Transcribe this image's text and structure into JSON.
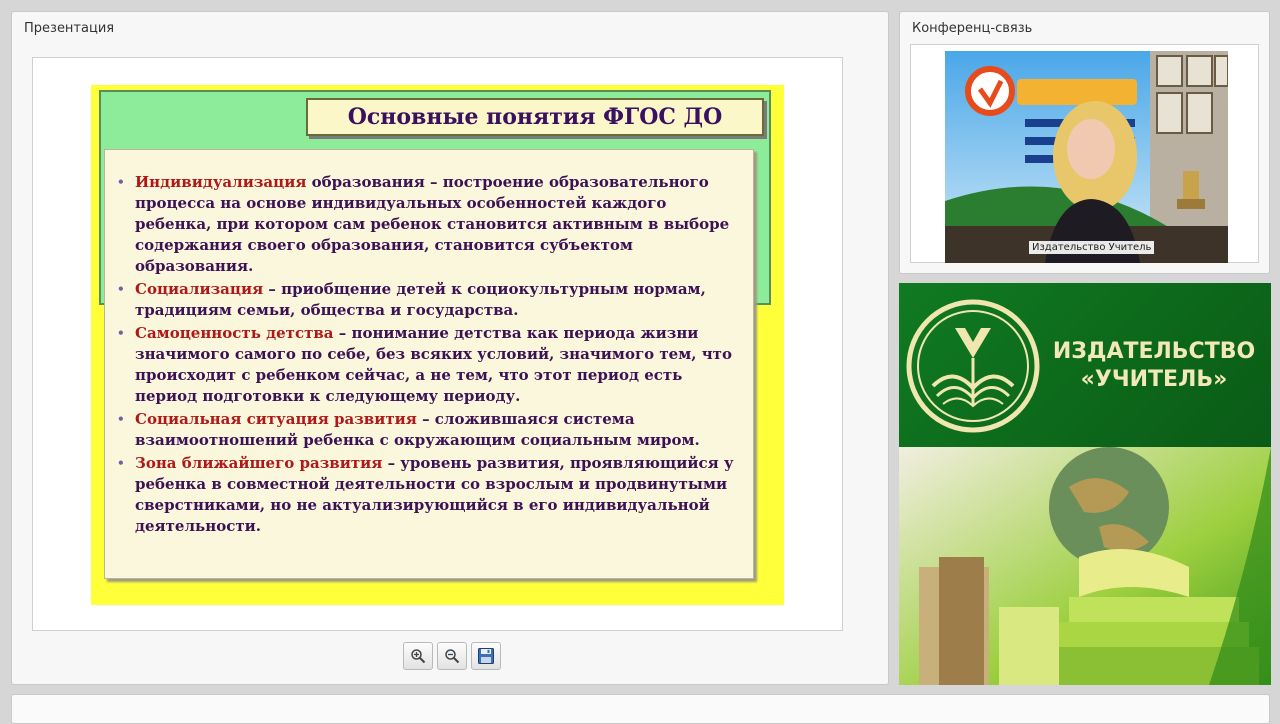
{
  "presentation": {
    "panel_title": "Презентация",
    "slide": {
      "title": "Основные понятия ФГОС ДО",
      "bullets": [
        {
          "term": "Индивидуализация",
          "text": " образования – построение образовательного процесса на основе индивидуальных особенностей каждого ребенка, при котором сам ребенок становится активным в выборе содержания своего образования, становится субъектом образования."
        },
        {
          "term": "Социализация",
          "text": " – приобщение детей к социокультурным нормам, традициям семьи, общества и государства."
        },
        {
          "term": "Самоценность детства",
          "text": " – понимание детства как периода жизни значимого самого по себе, без всяких условий, значимого тем, что происходит с ребенком сейчас, а не тем, что этот период есть период подготовки к следующему периоду."
        },
        {
          "term": "Социальная ситуация развития",
          "text": " – сложившаяся система взаимоотношений ребенка с окружающим социальным миром."
        },
        {
          "term": "Зона ближайшего развития",
          "text": " – уровень развития, проявляющийся у ребенка в совместной деятельности со взрослым и продвинутыми сверстниками, но не актуализирующийся в его индивидуальной деятельности."
        }
      ]
    },
    "toolbar": {
      "zoom_in_icon": "magnifier-plus",
      "zoom_out_icon": "magnifier-minus",
      "save_icon": "floppy-disk"
    }
  },
  "conference": {
    "panel_title": "Конференц-связь",
    "video_caption": "Издательство Учитель"
  },
  "publisher": {
    "name_line1": "ИЗДАТЕЛЬСТВО",
    "name_line2": "«УЧИТЕЛЬ»"
  },
  "colors": {
    "slide_background": "#ffff3a",
    "slide_header": "#8dec9a",
    "term_color": "#b01818",
    "text_color": "#3d1255",
    "publisher_green": "#0f6b1d"
  }
}
